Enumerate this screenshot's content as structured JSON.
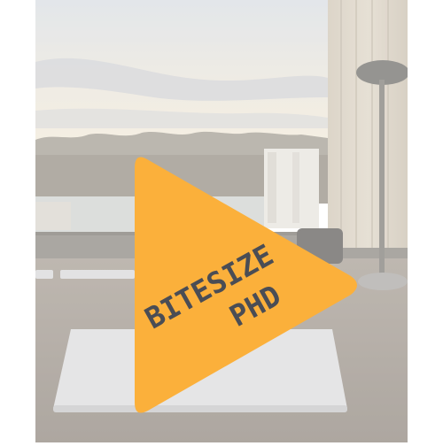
{
  "logo": {
    "line1": "BITESIZE",
    "line2": "PHD",
    "triangle_color": "#fbb03b",
    "text_color": "#4a4d55",
    "shape": "play-triangle"
  },
  "scene": {
    "description_icons": [
      "window-view",
      "desk-lamp",
      "laptop",
      "keyboard"
    ]
  }
}
